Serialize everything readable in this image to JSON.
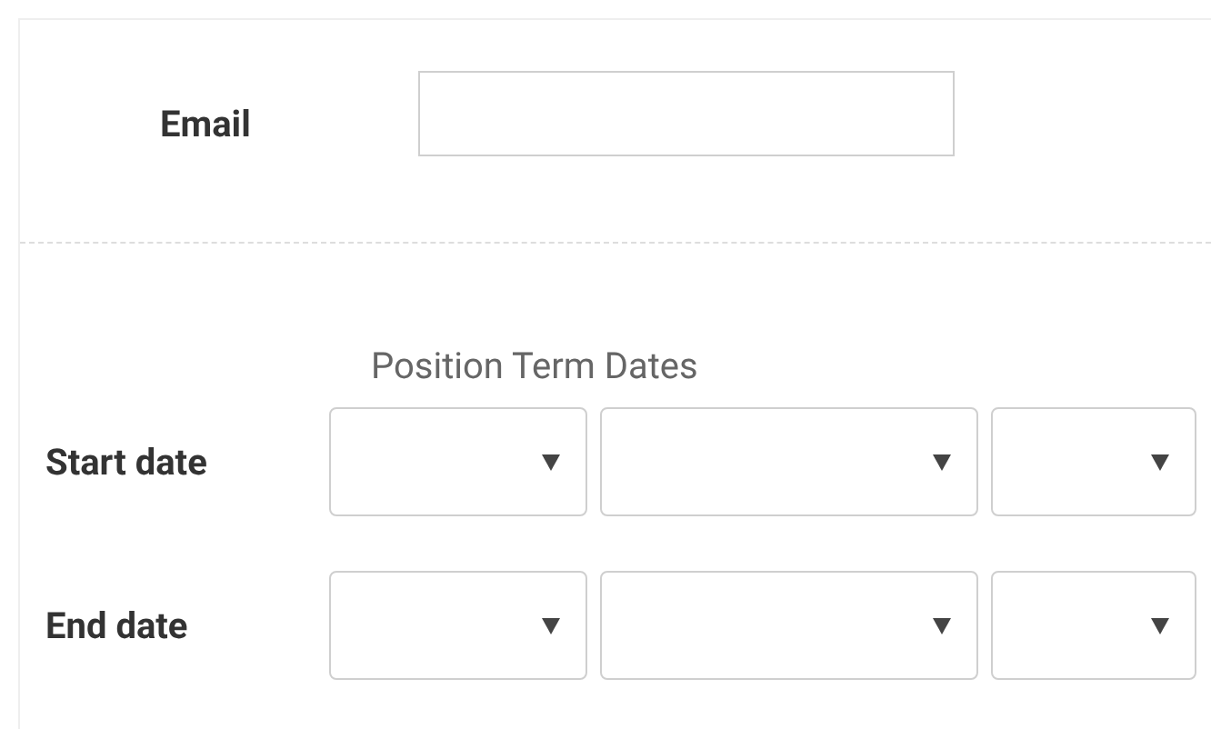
{
  "email": {
    "label": "Email"
  },
  "section_title": "Position Term Dates",
  "date_rows": [
    {
      "label": "Start date",
      "dropdowns": [
        {
          "kind": "day"
        },
        {
          "kind": "month"
        },
        {
          "kind": "year"
        }
      ]
    },
    {
      "label": "End date",
      "dropdowns": [
        {
          "kind": "day"
        },
        {
          "kind": "month"
        },
        {
          "kind": "year"
        }
      ]
    }
  ]
}
